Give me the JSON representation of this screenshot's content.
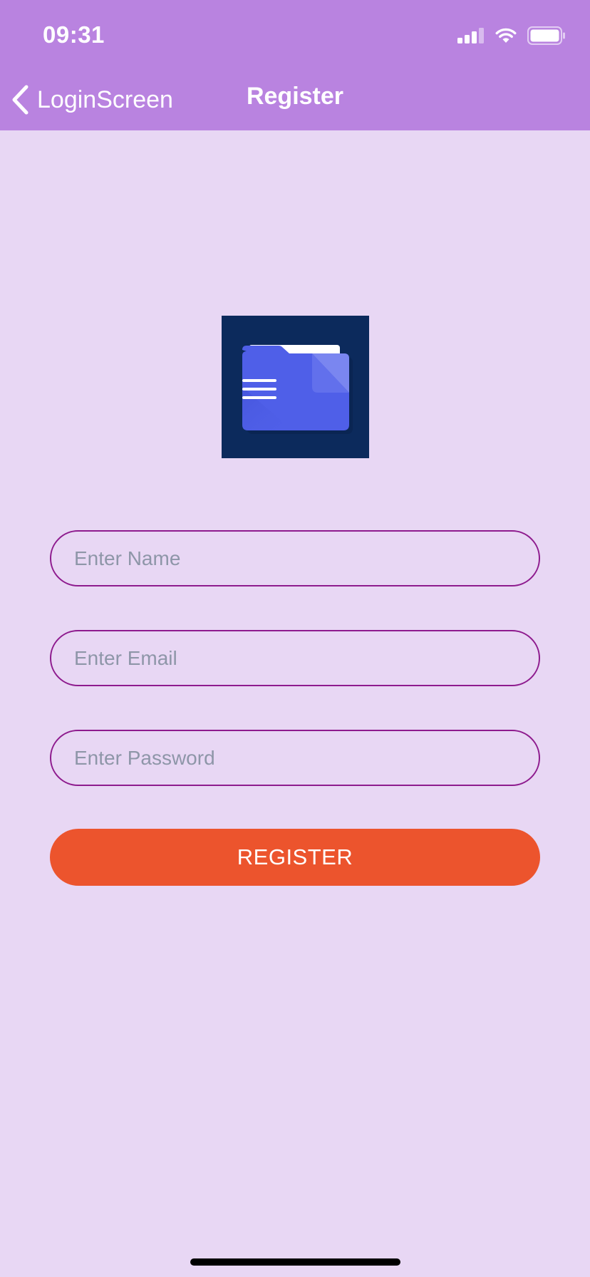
{
  "status_bar": {
    "time": "09:31",
    "icons": [
      "cellular-signal-icon",
      "wifi-icon",
      "battery-icon"
    ]
  },
  "nav_bar": {
    "back_label": "LoginScreen",
    "back_icon": "chevron-left-icon",
    "title": "Register"
  },
  "logo": {
    "icon": "document-folder-icon"
  },
  "form": {
    "name_placeholder": "Enter Name",
    "name_value": "",
    "email_placeholder": "Enter Email",
    "email_value": "",
    "password_placeholder": "Enter Password",
    "password_value": "",
    "register_label": "REGISTER"
  },
  "colors": {
    "header": "#B983E0",
    "background": "#E8D7F4",
    "field_border": "#8E1B8E",
    "button": "#EC542D",
    "logo_bg": "#0C2A5C"
  }
}
